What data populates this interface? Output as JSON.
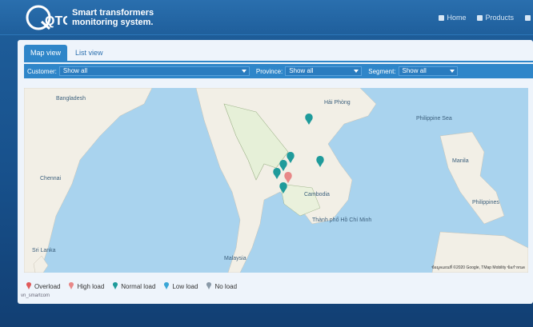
{
  "app": {
    "logo_text": "QTC",
    "brand_line1": "Smart transformers",
    "brand_line2": "monitoring system."
  },
  "nav": [
    {
      "label": "Home",
      "icon": "home-icon"
    },
    {
      "label": "Products",
      "icon": "user-icon"
    },
    {
      "label": "",
      "icon": "settings-icon"
    }
  ],
  "tabs": [
    {
      "label": "Map view",
      "active": true
    },
    {
      "label": "List view",
      "active": false
    }
  ],
  "filters": [
    {
      "label": "Customer:",
      "value": "Show all"
    },
    {
      "label": "Province:",
      "value": "Show all"
    },
    {
      "label": "Segment:",
      "value": "Show all"
    }
  ],
  "map": {
    "labels": [
      {
        "text": "Hải Phòng"
      },
      {
        "text": "Philippine Sea"
      },
      {
        "text": "Manila"
      },
      {
        "text": "Philippines"
      },
      {
        "text": "Cambodia"
      },
      {
        "text": "Thành phố Hồ Chí Minh"
      },
      {
        "text": "Bangladesh"
      },
      {
        "text": "Chennai"
      },
      {
        "text": "Sri Lanka"
      },
      {
        "text": "Malaysia"
      }
    ],
    "attribution": "ข้อมูลแผนที่ ©2020 Google, TMap Mobility   ข้อกำหนด"
  },
  "legend": [
    {
      "label": "Overload",
      "color": "#e05a5a"
    },
    {
      "label": "High load",
      "color": "#e88888"
    },
    {
      "label": "Normal load",
      "color": "#1f9b9b"
    },
    {
      "label": "Low load",
      "color": "#3aa6d6"
    },
    {
      "label": "No load",
      "color": "#8a9aa8"
    }
  ],
  "legend_note": "vn_smartcom",
  "colors": {
    "accent": "#2f86c9",
    "header_bg": "#1f5f9c",
    "sea": "#a9d3ee",
    "land": "#f2efe6"
  }
}
